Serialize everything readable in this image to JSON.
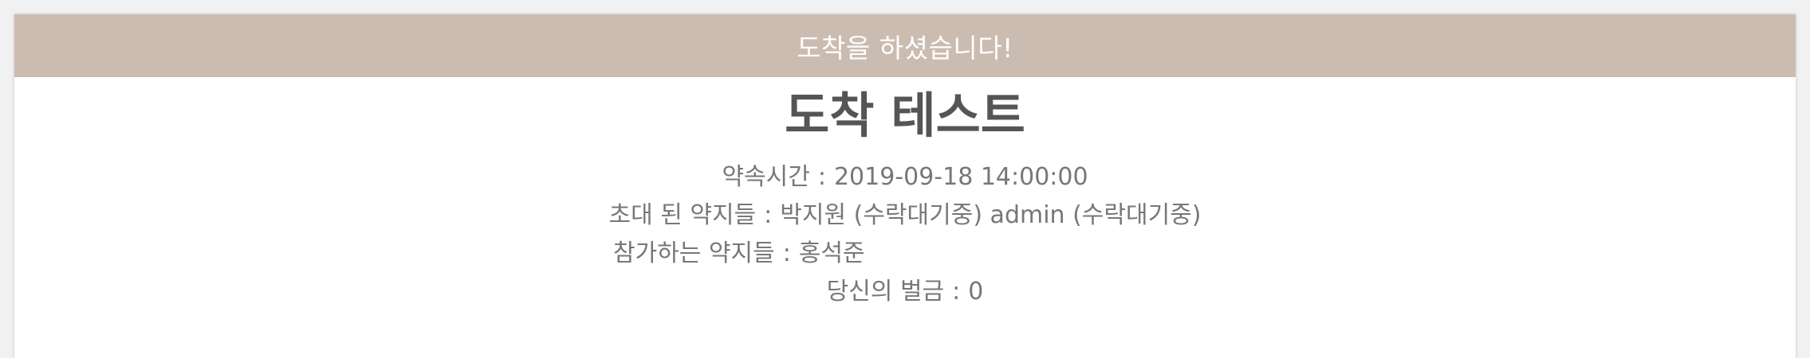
{
  "banner": {
    "text": "도착을 하셨습니다!"
  },
  "page": {
    "title": "도착 테스트"
  },
  "info": {
    "appointment_time_label": "약속시간",
    "appointment_time_value": "2019-09-18 14:00:00",
    "invited_label": "초대 된 약지들",
    "invited_value": "박지원 (수락대기중) admin (수락대기중)",
    "participating_label": "참가하는 약지들",
    "participating_value": "홍석준",
    "fine_label": "당신의 벌금",
    "fine_value": "0",
    "separator": ":"
  },
  "colors": {
    "banner_bg": "#cbbcb1",
    "banner_text": "#ffffff",
    "title_text": "#555555",
    "info_text": "#777777"
  }
}
